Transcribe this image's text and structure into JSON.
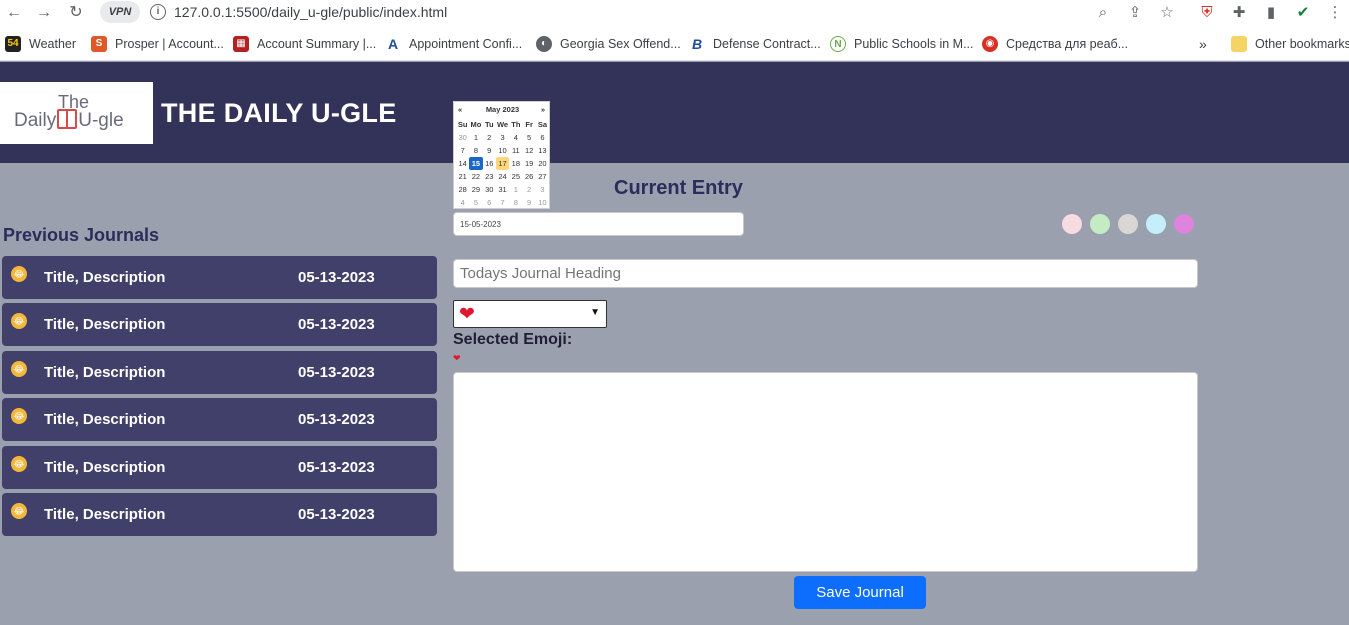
{
  "browser": {
    "url": "127.0.0.1:5500/daily_u-gle/public/index.html",
    "vpn_label": "VPN",
    "bookmarks": [
      {
        "label": "Weather",
        "icon": "weather-icon",
        "color": "#1a1a1a"
      },
      {
        "label": "Prosper | Account...",
        "icon": "prosper-icon",
        "color": "#e0582a"
      },
      {
        "label": "Account Summary |...",
        "icon": "grid-icon",
        "color": "#b22222"
      },
      {
        "label": "Appointment Confi...",
        "icon": "appointment-icon",
        "color": "#1f4e9c"
      },
      {
        "label": "Georgia Sex Offend...",
        "icon": "globe-icon",
        "color": "#5f6368"
      },
      {
        "label": "Defense Contract...",
        "icon": "defense-icon",
        "color": "#1f4e9c"
      },
      {
        "label": "Public Schools in M...",
        "icon": "schools-icon",
        "color": "#6aa84f"
      },
      {
        "label": "Средства для реаб...",
        "icon": "store-icon",
        "color": "#d93025"
      }
    ],
    "other_bookmarks": "Other bookmarks"
  },
  "header": {
    "logo_the": "The",
    "logo_daily": "Daily",
    "logo_ugle": "U-gle",
    "title": "THE DAILY U-GLE"
  },
  "calendar": {
    "prev": "«",
    "next": "»",
    "month_label": "May 2023",
    "weekdays": [
      "Su",
      "Mo",
      "Tu",
      "We",
      "Th",
      "Fr",
      "Sa"
    ],
    "days": [
      {
        "d": "30",
        "muted": true
      },
      {
        "d": "1"
      },
      {
        "d": "2"
      },
      {
        "d": "3"
      },
      {
        "d": "4"
      },
      {
        "d": "5"
      },
      {
        "d": "6"
      },
      {
        "d": "7"
      },
      {
        "d": "8"
      },
      {
        "d": "9"
      },
      {
        "d": "10"
      },
      {
        "d": "11"
      },
      {
        "d": "12"
      },
      {
        "d": "13"
      },
      {
        "d": "14"
      },
      {
        "d": "15",
        "selected": true
      },
      {
        "d": "16"
      },
      {
        "d": "17",
        "today": true
      },
      {
        "d": "18"
      },
      {
        "d": "19"
      },
      {
        "d": "20"
      },
      {
        "d": "21"
      },
      {
        "d": "22"
      },
      {
        "d": "23"
      },
      {
        "d": "24"
      },
      {
        "d": "25"
      },
      {
        "d": "26"
      },
      {
        "d": "27"
      },
      {
        "d": "28"
      },
      {
        "d": "29"
      },
      {
        "d": "30"
      },
      {
        "d": "31"
      },
      {
        "d": "1",
        "muted": true
      },
      {
        "d": "2",
        "muted": true
      },
      {
        "d": "3",
        "muted": true
      },
      {
        "d": "4",
        "muted": true
      },
      {
        "d": "5",
        "muted": true
      },
      {
        "d": "6",
        "muted": true
      },
      {
        "d": "7",
        "muted": true
      },
      {
        "d": "8",
        "muted": true
      },
      {
        "d": "9",
        "muted": true
      },
      {
        "d": "10",
        "muted": true
      }
    ]
  },
  "previous": {
    "title": "Previous Journals",
    "items": [
      {
        "title": "Title, Description",
        "date": "05-13-2023",
        "emoji": "😂"
      },
      {
        "title": "Title, Description",
        "date": "05-13-2023",
        "emoji": "😂"
      },
      {
        "title": "Title, Description",
        "date": "05-13-2023",
        "emoji": "😂"
      },
      {
        "title": "Title, Description",
        "date": "05-13-2023",
        "emoji": "😂"
      },
      {
        "title": "Title, Description",
        "date": "05-13-2023",
        "emoji": "😂"
      },
      {
        "title": "Title, Description",
        "date": "05-13-2023",
        "emoji": "😂"
      }
    ]
  },
  "entry": {
    "title": "Current Entry",
    "date_value": "15-05-2023",
    "heading_placeholder": "Todays Journal Heading",
    "emoji_selected": "❤",
    "selected_label": "Selected Emoji:",
    "selected_emoji": "❤",
    "save_label": "Save Journal",
    "color_options": [
      "#f7dbe0",
      "#c3ecc5",
      "#d9d6d4",
      "#c4eefb",
      "#de83de"
    ]
  }
}
